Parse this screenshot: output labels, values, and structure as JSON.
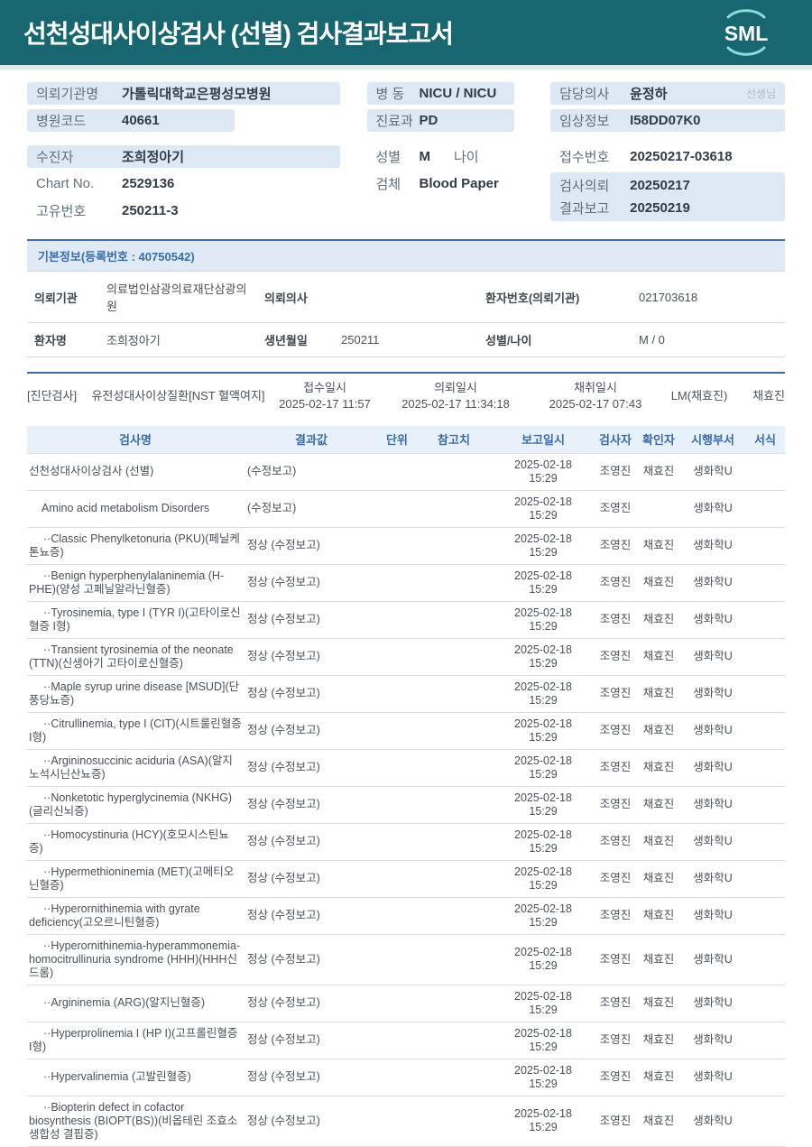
{
  "header": {
    "title": "선천성대사이상검사 (선별) 검사결과보고서",
    "logo": "SML"
  },
  "colors": {
    "header_bg": "#186770",
    "chip_bg": "#dce8f4",
    "accent_blue": "#3a6ca6"
  },
  "info": {
    "req_org_label": "의뢰기관명",
    "req_org_value": "가톨릭대학교은평성모병원",
    "hosp_code_label": "병원코드",
    "hosp_code_value": "40661",
    "patient_label": "수진자",
    "patient_value": "조희정아기",
    "chart_label": "Chart No.",
    "chart_value": "2529136",
    "uid_label": "고유번호",
    "uid_value": "250211-3",
    "ward_label": "병 동",
    "ward_value": "NICU / NICU",
    "dept_label": "진료과",
    "dept_value": "PD",
    "sex_label": "성별",
    "sex_value": "M",
    "age_label": "나이",
    "age_value": "",
    "specimen_label": "검체",
    "specimen_value": "Blood Paper",
    "doctor_label": "담당의사",
    "doctor_value": "윤정하",
    "doctor_suffix": "선생님",
    "clinical_label": "임상정보",
    "clinical_value": "I58DD07K0",
    "recv_no_label": "접수번호",
    "recv_no_value": "20250217-03618",
    "order_label": "검사의뢰",
    "order_value": "20250217",
    "report_label": "결과보고",
    "report_value": "20250219"
  },
  "basic": {
    "title": "기본정보(등록번호 : 40750542)",
    "org_label": "의뢰기관",
    "org_value": "의료법인삼광의료재단삼광의원",
    "doctor_label": "의뢰의사",
    "doctor_value": "",
    "pid_label": "환자번호(의뢰기관)",
    "pid_value": "021703618",
    "name_label": "환자명",
    "name_value": "조희정아기",
    "birth_label": "생년월일",
    "birth_value": "250211",
    "sexage_label": "성별/나이",
    "sexage_value": "M / 0"
  },
  "diagnosis": {
    "tag": "[진단검사]",
    "group": "유전성대사이상질환[NST 혈액여지]",
    "recv_label": "접수일시",
    "recv_value": "2025-02-17 11:57",
    "order_label": "의뢰일시",
    "order_value": "2025-02-17 11:34:18",
    "collect_label": "채취일시",
    "collect_value": "2025-02-17 07:43",
    "lm": "LM(채효진)",
    "collector": "채효진"
  },
  "table": {
    "headers": [
      "검사명",
      "결과값",
      "단위",
      "참고치",
      "보고일시",
      "검사자",
      "확인자",
      "시행부서",
      "서식"
    ],
    "rows": [
      {
        "name": "선천성대사이상검사 (선별)",
        "result": "(수정보고)",
        "date": "2025-02-18",
        "time": "15:29",
        "tester": "조영진",
        "checker": "채효진",
        "dept": "생화학U",
        "indent": 0
      },
      {
        "name": "Amino acid metabolism Disorders",
        "result": "(수정보고)",
        "date": "2025-02-18",
        "time": "15:29",
        "tester": "조영진",
        "checker": "",
        "dept": "생화학U",
        "indent": 1
      },
      {
        "name": "··Classic Phenylketonuria (PKU)(페닐케톤뇨증)",
        "result": "정상 (수정보고)",
        "date": "2025-02-18",
        "time": "15:29",
        "tester": "조영진",
        "checker": "채효진",
        "dept": "생화학U",
        "indent": 2
      },
      {
        "name": "··Benign hyperphenylalaninemia (H-PHE)(양성 고페닐알라닌혈증)",
        "result": "정상 (수정보고)",
        "date": "2025-02-18",
        "time": "15:29",
        "tester": "조영진",
        "checker": "채효진",
        "dept": "생화학U",
        "indent": 2
      },
      {
        "name": "··Tyrosinemia, type I (TYR I)(고타이로신혈증 I형)",
        "result": "정상 (수정보고)",
        "date": "2025-02-18",
        "time": "15:29",
        "tester": "조영진",
        "checker": "채효진",
        "dept": "생화학U",
        "indent": 2
      },
      {
        "name": "··Transient tyrosinemia of the neonate (TTN)(신생아기 고타이로신혈증)",
        "result": "정상 (수정보고)",
        "date": "2025-02-18",
        "time": "15:29",
        "tester": "조영진",
        "checker": "채효진",
        "dept": "생화학U",
        "indent": 2
      },
      {
        "name": "··Maple syrup urine disease [MSUD](단풍당뇨증)",
        "result": "정상 (수정보고)",
        "date": "2025-02-18",
        "time": "15:29",
        "tester": "조영진",
        "checker": "채효진",
        "dept": "생화학U",
        "indent": 2
      },
      {
        "name": "··Citrullinemia, type I (CIT)(시트룰린혈증 I형)",
        "result": "정상 (수정보고)",
        "date": "2025-02-18",
        "time": "15:29",
        "tester": "조영진",
        "checker": "채효진",
        "dept": "생화학U",
        "indent": 2
      },
      {
        "name": "··Argininosuccinic aciduria (ASA)(알지노석시닌산뇨증)",
        "result": "정상 (수정보고)",
        "date": "2025-02-18",
        "time": "15:29",
        "tester": "조영진",
        "checker": "채효진",
        "dept": "생화학U",
        "indent": 2
      },
      {
        "name": "··Nonketotic hyperglycinemia (NKHG)(글리신뇌증)",
        "result": "정상 (수정보고)",
        "date": "2025-02-18",
        "time": "15:29",
        "tester": "조영진",
        "checker": "채효진",
        "dept": "생화학U",
        "indent": 2
      },
      {
        "name": "··Homocystinuria (HCY)(호모시스틴뇨증)",
        "result": "정상 (수정보고)",
        "date": "2025-02-18",
        "time": "15:29",
        "tester": "조영진",
        "checker": "채효진",
        "dept": "생화학U",
        "indent": 2
      },
      {
        "name": "··Hypermethioninemia (MET)(고메티오닌혈증)",
        "result": "정상 (수정보고)",
        "date": "2025-02-18",
        "time": "15:29",
        "tester": "조영진",
        "checker": "채효진",
        "dept": "생화학U",
        "indent": 2
      },
      {
        "name": "··Hyperornithinemia with gyrate deficiency(고오르니틴혈증)",
        "result": "정상 (수정보고)",
        "date": "2025-02-18",
        "time": "15:29",
        "tester": "조영진",
        "checker": "채효진",
        "dept": "생화학U",
        "indent": 2
      },
      {
        "name": "··Hyperornithinemia-hyperammonemia-homocitrullinuria syndrome (HHH)(HHH신드롬)",
        "result": "정상 (수정보고)",
        "date": "2025-02-18",
        "time": "15:29",
        "tester": "조영진",
        "checker": "채효진",
        "dept": "생화학U",
        "indent": 2
      },
      {
        "name": "··Argininemia (ARG)(알지닌혈증)",
        "result": "정상 (수정보고)",
        "date": "2025-02-18",
        "time": "15:29",
        "tester": "조영진",
        "checker": "채효진",
        "dept": "생화학U",
        "indent": 2
      },
      {
        "name": "··Hyperprolinemia I (HP I)(고프롤린혈증 I형)",
        "result": "정상 (수정보고)",
        "date": "2025-02-18",
        "time": "15:29",
        "tester": "조영진",
        "checker": "채효진",
        "dept": "생화학U",
        "indent": 2
      },
      {
        "name": "··Hypervalinemia (고발린혈증)",
        "result": "정상 (수정보고)",
        "date": "2025-02-18",
        "time": "15:29",
        "tester": "조영진",
        "checker": "채효진",
        "dept": "생화학U",
        "indent": 2
      },
      {
        "name": "··Biopterin defect in cofactor biosynthesis (BIOPT(BS))(비옵테린 조효소 생합성 결핍증)",
        "result": "정상 (수정보고)",
        "date": "2025-02-18",
        "time": "15:29",
        "tester": "조영진",
        "checker": "채효진",
        "dept": "생화학U",
        "indent": 2
      }
    ]
  }
}
